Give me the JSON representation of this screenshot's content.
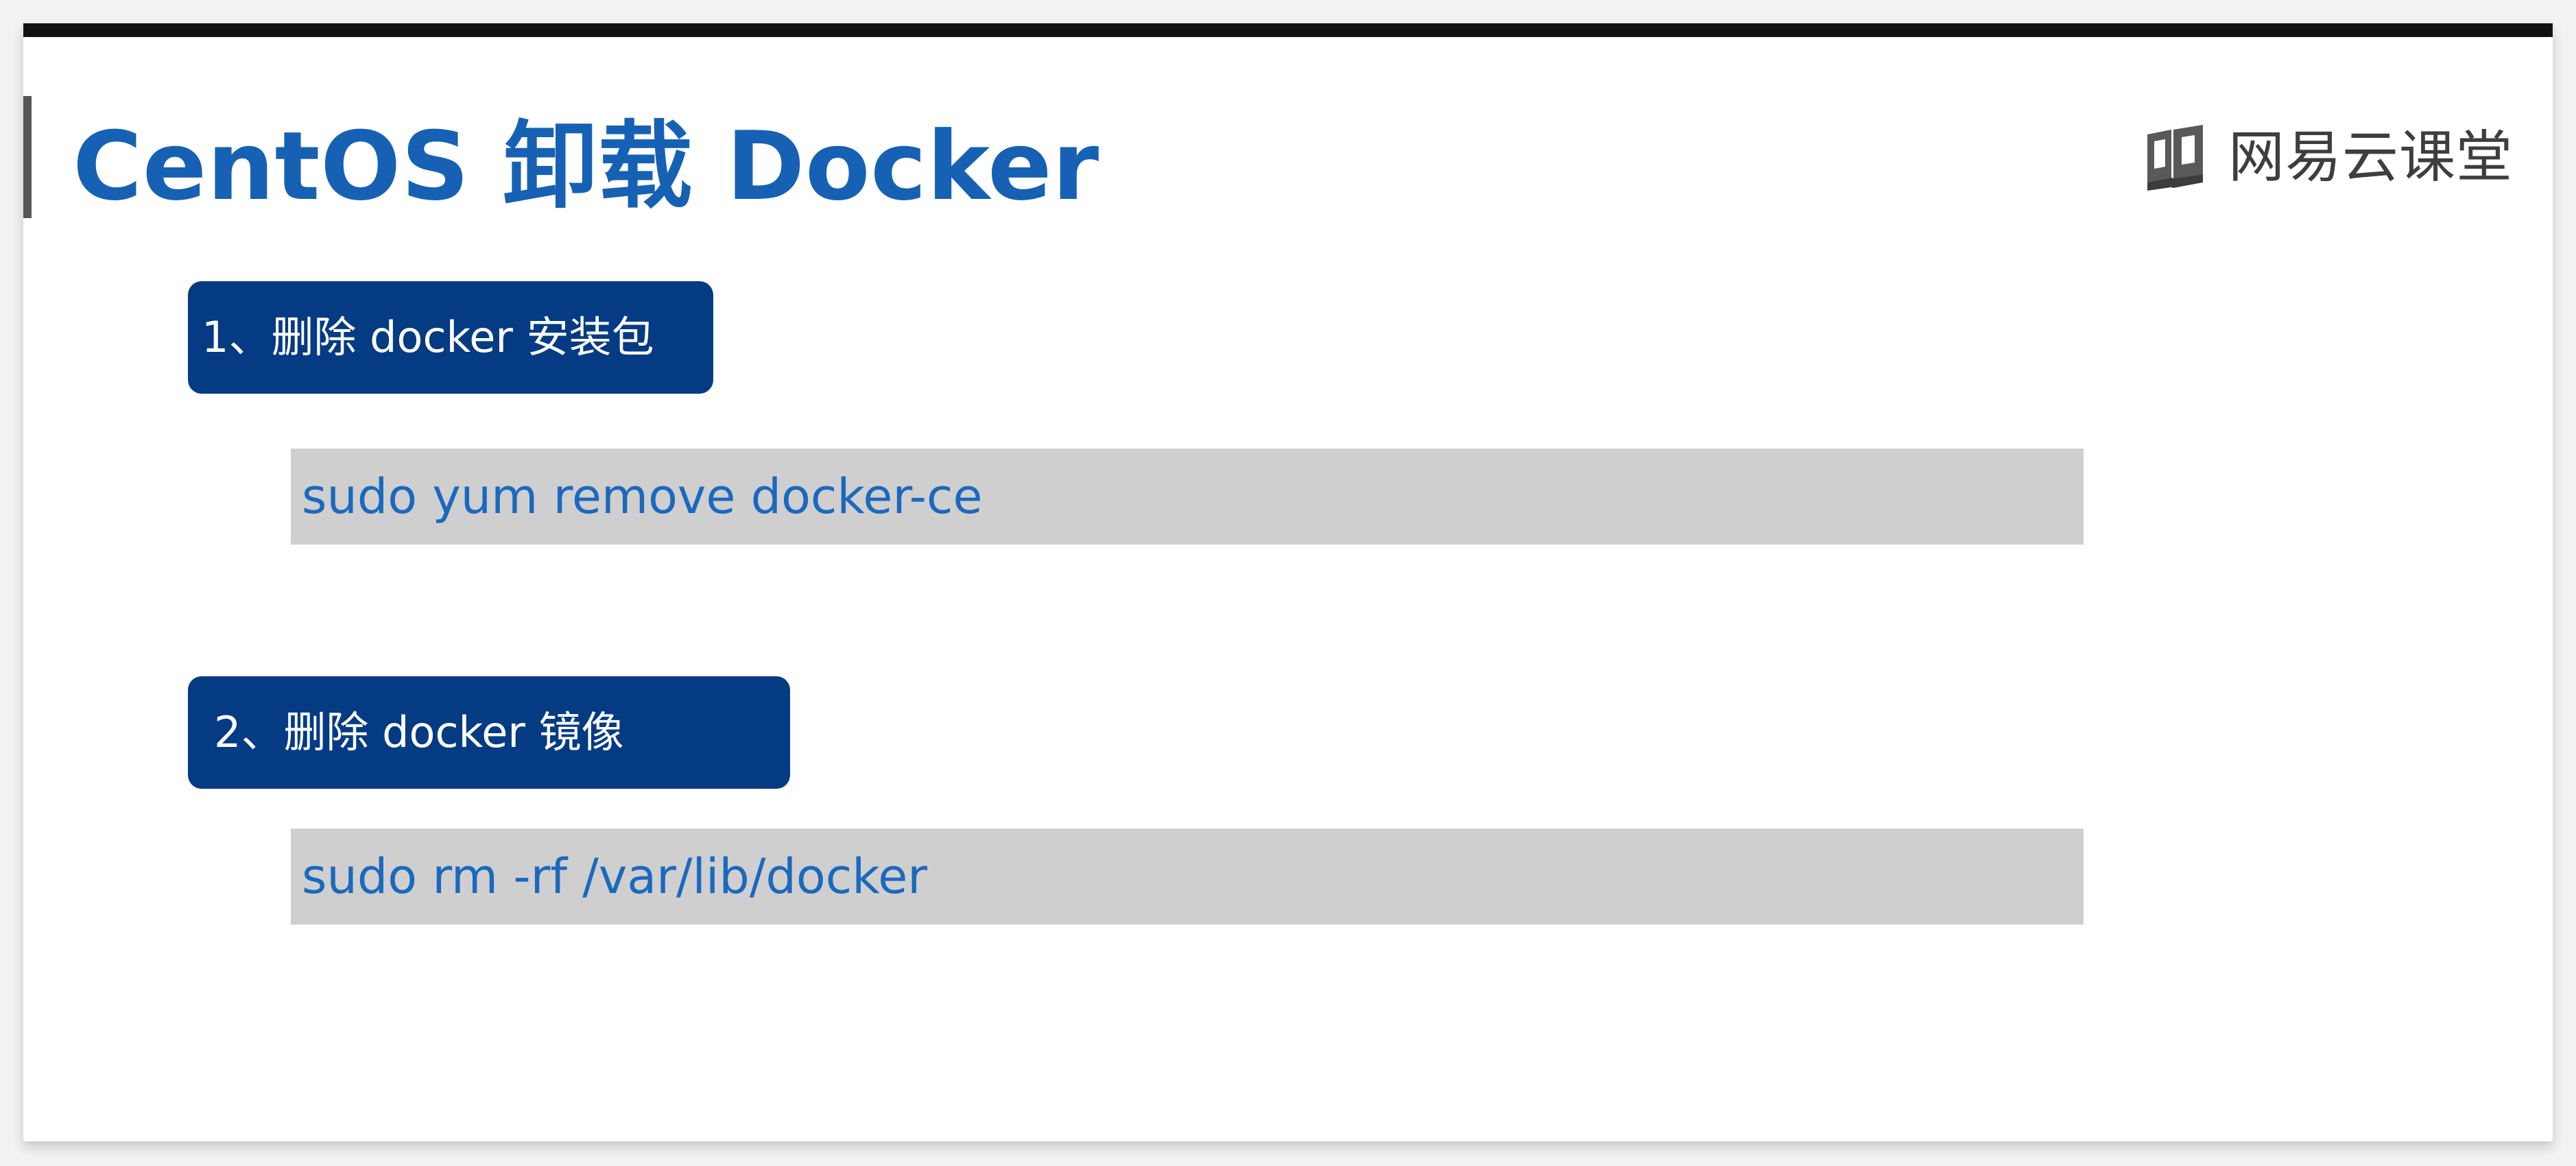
{
  "colors": {
    "page_background": "#f2f2f2",
    "slide_background": "#ffffff",
    "top_bar": "#111111",
    "title_accent": "#555555",
    "title": "#1661b3",
    "step_background": "#043b82",
    "step_text": "#ffffff",
    "command_background": "#cfcfcf",
    "command_text": "#1b69bd",
    "brand_text": "#3e3e3e"
  },
  "slide": {
    "title": "CentOS 卸载 Docker"
  },
  "brand": {
    "icon": "book-icon",
    "name": "网易云课堂"
  },
  "steps": [
    {
      "label": "1、删除 docker 安装包",
      "command": "sudo yum remove docker-ce"
    },
    {
      "label": "2、删除 docker 镜像",
      "command": "sudo rm -rf /var/lib/docker"
    }
  ]
}
